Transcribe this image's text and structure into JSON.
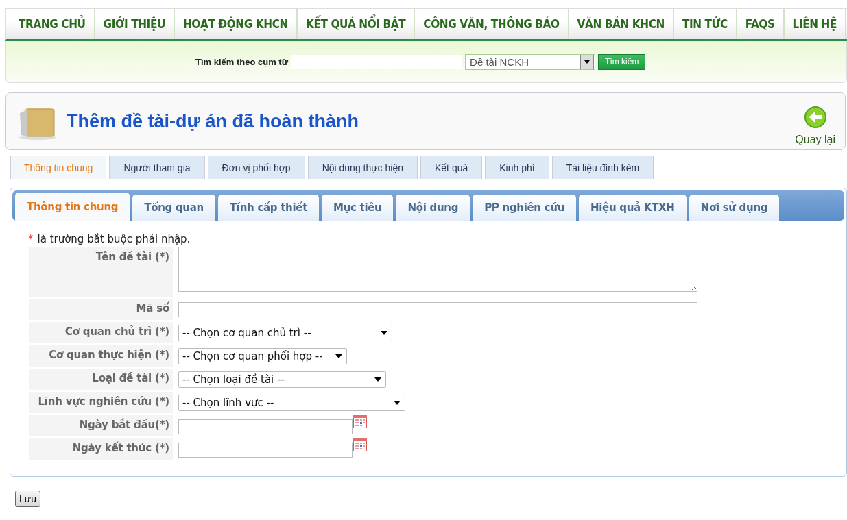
{
  "nav": [
    {
      "label": "TRANG CHỦ"
    },
    {
      "label": "GIỚI THIỆU"
    },
    {
      "label": "HOẠT ĐỘNG KHCN"
    },
    {
      "label": "KẾT QUẢ NỔI BẬT"
    },
    {
      "label": "CÔNG VĂN, THÔNG BÁO"
    },
    {
      "label": "VĂN BẢN KHCN"
    },
    {
      "label": "TIN TỨC"
    },
    {
      "label": "FAQS"
    },
    {
      "label": "LIÊN HỆ"
    }
  ],
  "search": {
    "label": "Tìm kiếm theo cụm từ",
    "category": "Đề tài NCKH",
    "button": "Tìm kiếm"
  },
  "page_title": "Thêm đề tài-dự án đã hoàn thành",
  "back_button": "Quay lại",
  "tabs": [
    {
      "label": "Thông tin chung",
      "selected": true
    },
    {
      "label": "Người tham gia",
      "selected": false
    },
    {
      "label": "Đơn vị phối hợp",
      "selected": false
    },
    {
      "label": "Nội dung thực hiện",
      "selected": false
    },
    {
      "label": "Kết quả",
      "selected": false
    },
    {
      "label": "Kinh phí",
      "selected": false
    },
    {
      "label": "Tài liệu đính kèm",
      "selected": false
    }
  ],
  "subtabs": [
    {
      "label": "Thông tin chung",
      "selected": true
    },
    {
      "label": "Tổng quan",
      "selected": false
    },
    {
      "label": "Tính cấp thiết",
      "selected": false
    },
    {
      "label": "Mục tiêu",
      "selected": false
    },
    {
      "label": "Nội dung",
      "selected": false
    },
    {
      "label": "PP nghiên cứu",
      "selected": false
    },
    {
      "label": "Hiệu quả KTXH",
      "selected": false
    },
    {
      "label": "Nơi sử dụng",
      "selected": false
    }
  ],
  "required_note": {
    "mark": "*",
    "text": "là trường bắt buộc phải nhập."
  },
  "fields": [
    {
      "label": "Tên đề tài (*)",
      "kind": "textarea"
    },
    {
      "label": "Mã số",
      "kind": "text"
    },
    {
      "label": "Cơ quan chủ trì (*)",
      "kind": "select",
      "value": "-- Chọn cơ quan chủ trì --"
    },
    {
      "label": "Cơ quan thực hiện (*)",
      "kind": "select",
      "value": "-- Chọn cơ quan phối hợp --"
    },
    {
      "label": "Loại đề tài (*)",
      "kind": "select",
      "value": "-- Chọn loại đề tài --"
    },
    {
      "label": "Lĩnh vực nghiên cứu (*)",
      "kind": "select",
      "value": "-- Chọn lĩnh vực --"
    },
    {
      "label": "Ngày bắt đầu(*)",
      "kind": "date"
    },
    {
      "label": "Ngày kết thúc (*)",
      "kind": "date"
    }
  ],
  "save_button": "Lưu"
}
